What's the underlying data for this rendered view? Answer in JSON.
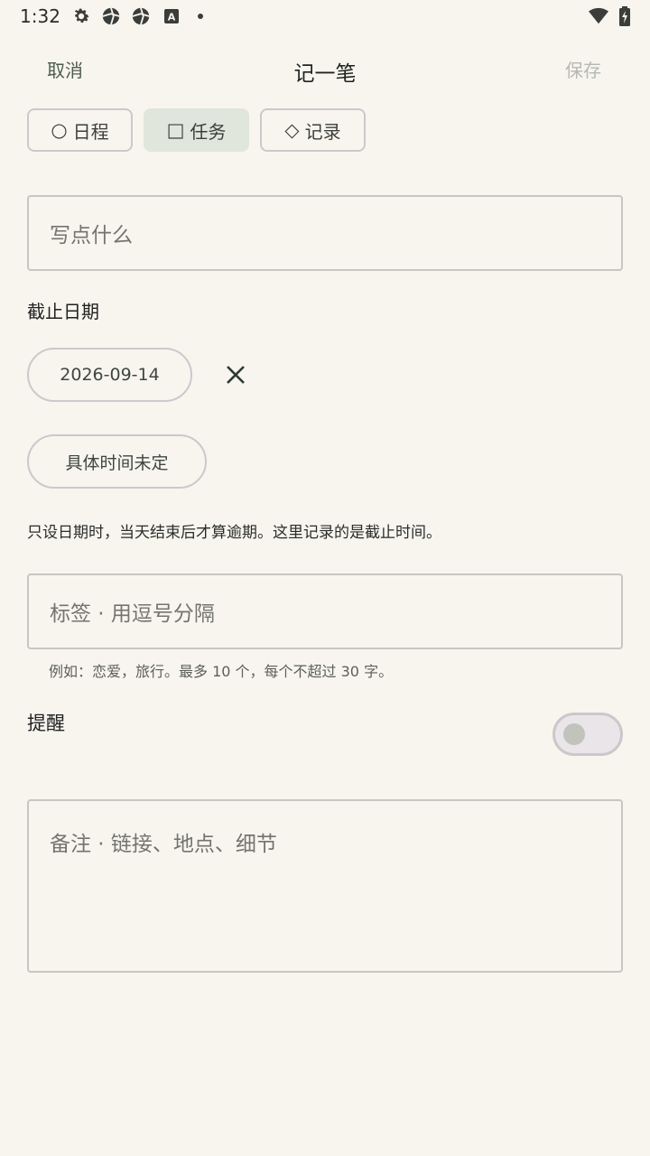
{
  "status_bar": {
    "time": "1:32",
    "icons": [
      "gear-icon",
      "aperture-icon",
      "aperture-icon",
      "keyboard-a-icon",
      "dot-icon"
    ],
    "right_icons": [
      "wifi-icon",
      "battery-charging-icon"
    ]
  },
  "header": {
    "cancel": "取消",
    "title": "记一笔",
    "save": "保存"
  },
  "types": [
    {
      "glyph": "○",
      "label": "日程"
    },
    {
      "glyph": "□",
      "label": "任务"
    },
    {
      "glyph": "◇",
      "label": "记录"
    }
  ],
  "title_field": {
    "placeholder": "写点什么"
  },
  "deadline": {
    "label": "截止日期",
    "date": "2026-09-14",
    "clear_glyph": "✕",
    "time_button": "具体时间未定",
    "hint": "只设日期时，当天结束后才算逾期。这里记录的是截止时间。"
  },
  "tags": {
    "placeholder": "标签 · 用逗号分隔",
    "hint": "例如：恋爱，旅行。最多 10 个，每个不超过 30 字。"
  },
  "reminder": {
    "label": "提醒"
  },
  "notes": {
    "placeholder": "备注 · 链接、地点、细节"
  },
  "colors": {
    "background": "#f8f5ef",
    "accent_selected": "#e1e6dc",
    "border": "#c8c6c0"
  }
}
